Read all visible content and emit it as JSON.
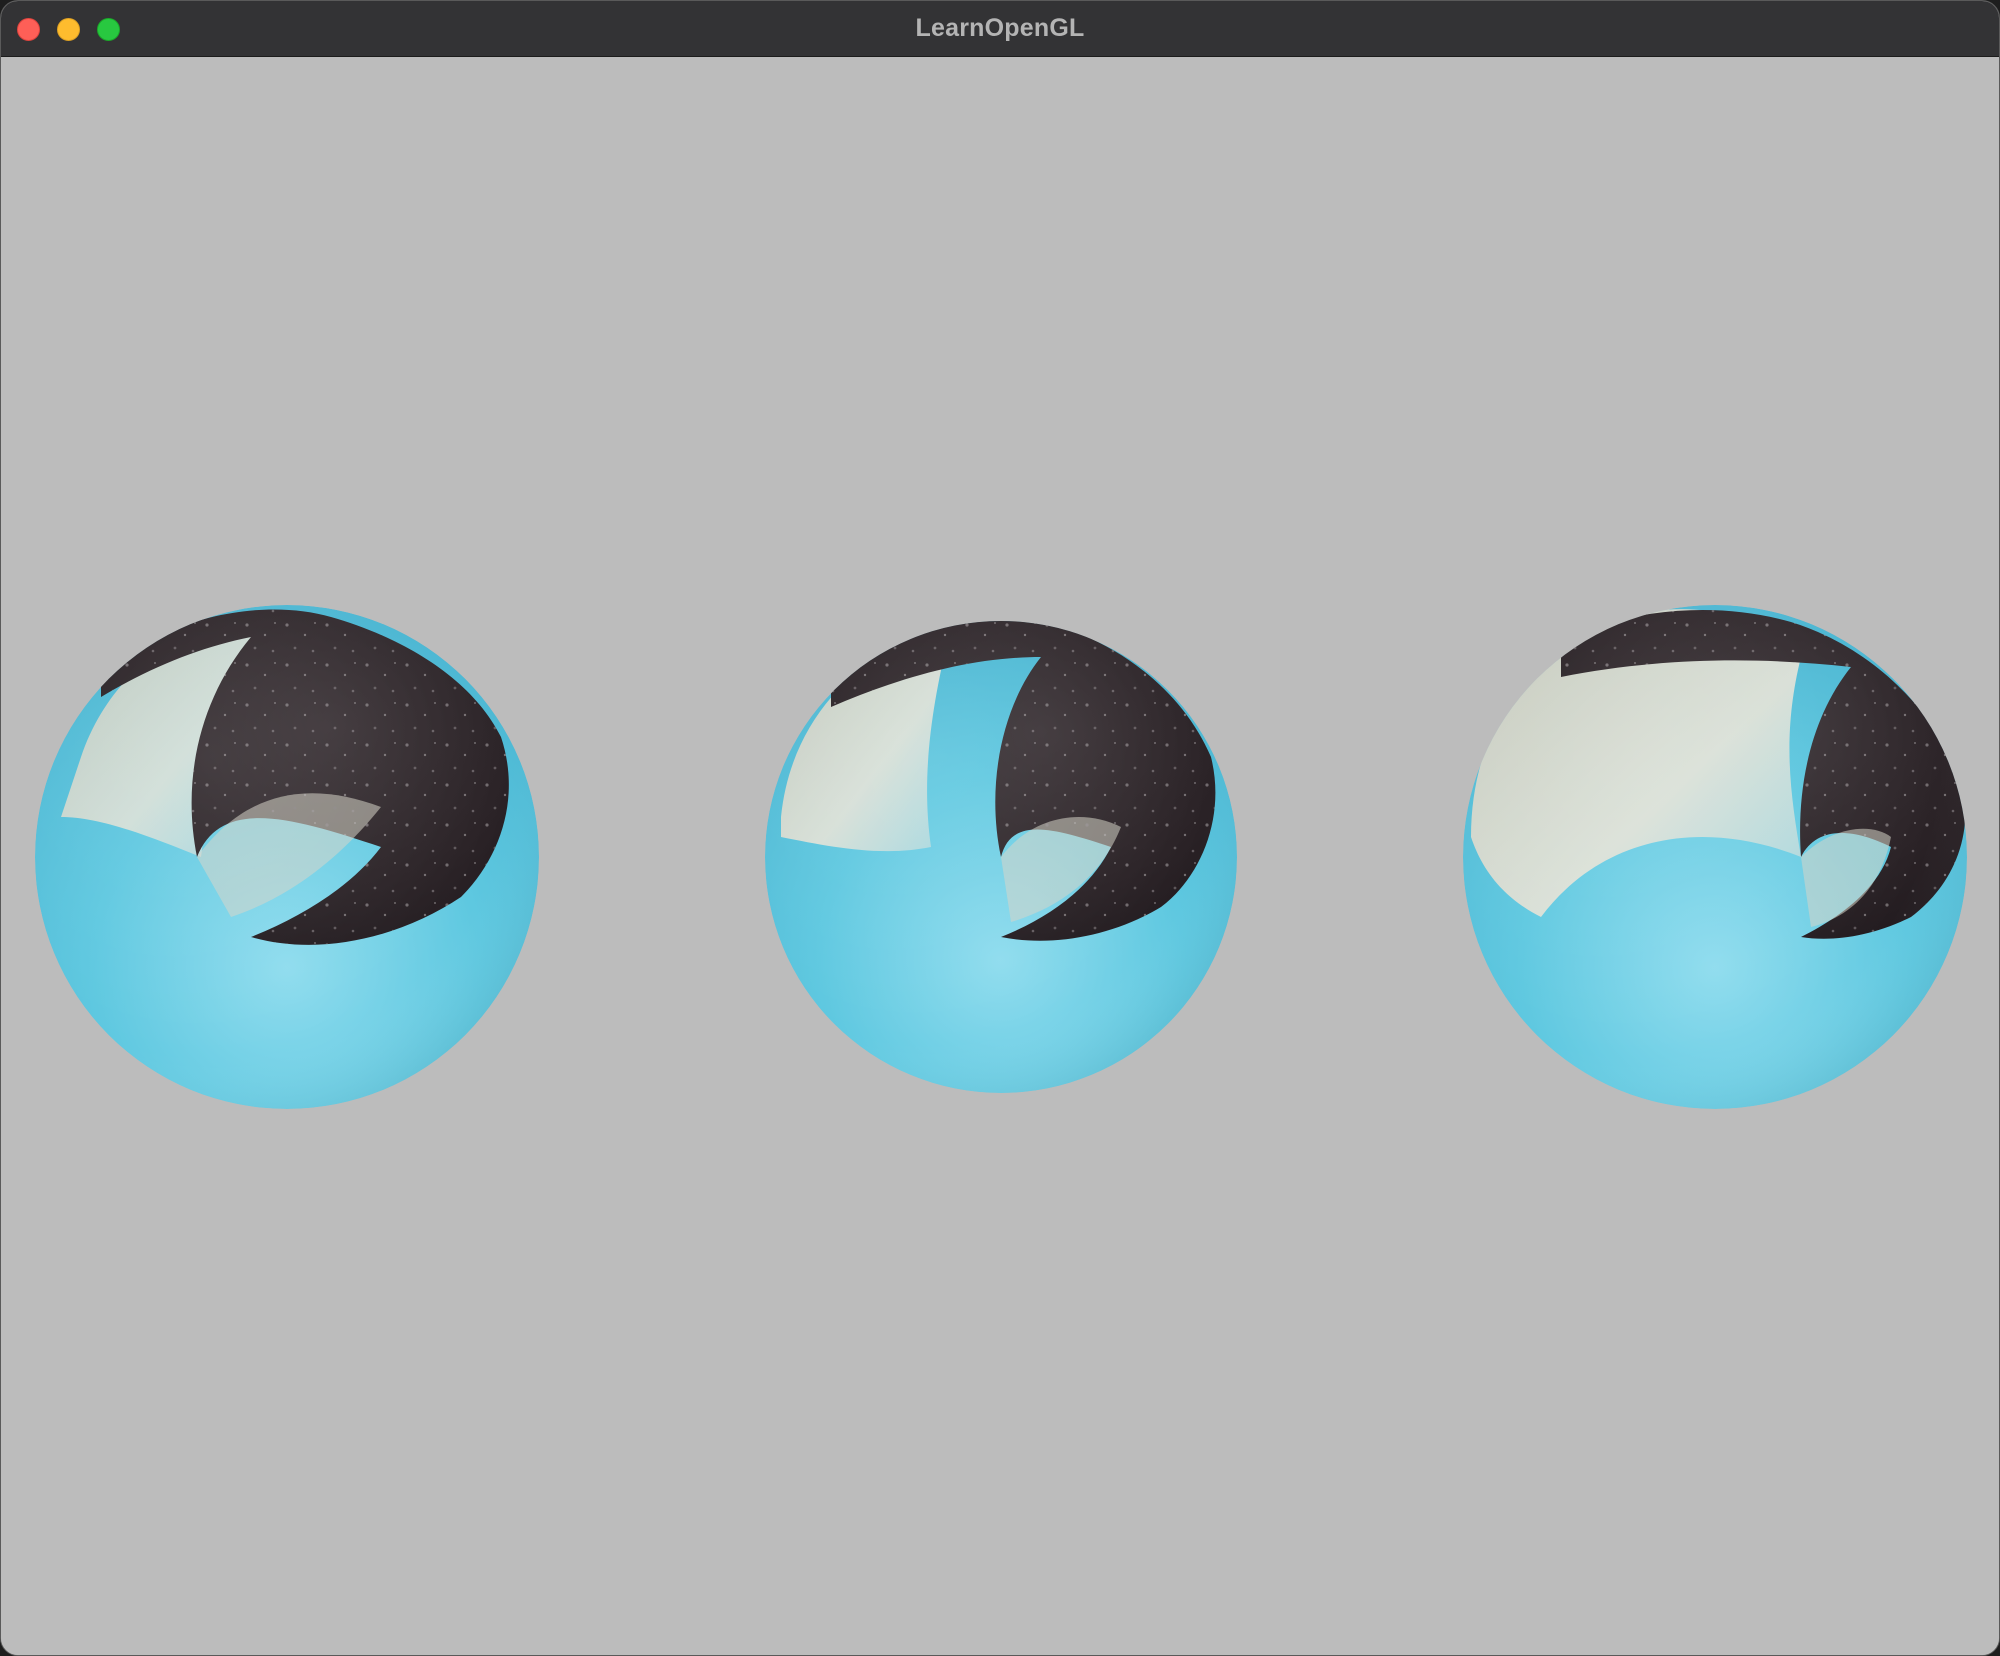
{
  "window": {
    "title": "LearnOpenGL",
    "controls": [
      "close",
      "minimize",
      "zoom"
    ]
  },
  "scene": {
    "clear_color": "#bcbcbc",
    "object_count": 3,
    "object_type": "textured sphere",
    "colors": {
      "ocean": "#5ec8e0",
      "ocean_light": "#8fdcee",
      "foam": "#d8d6c8",
      "dark": "#2a2226",
      "dark_mid": "#3a3236"
    }
  }
}
